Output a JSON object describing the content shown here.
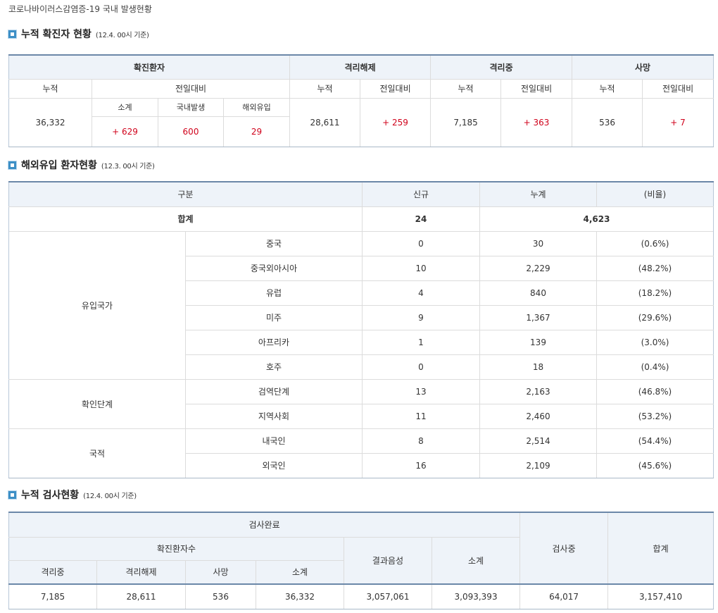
{
  "page_title": "코로나바이러스감염증-19 국내 발생현황",
  "section1": {
    "title": "누적 확진자 현황",
    "note": "(12.4. 00시 기준)",
    "headers": {
      "confirmed": "확진환자",
      "released": "격리해제",
      "isolated": "격리중",
      "deaths": "사망",
      "cumulative": "누적",
      "daily_change": "전일대비",
      "subtotal": "소계",
      "domestic": "국내발생",
      "imported": "해외유입"
    },
    "values": {
      "confirmed_cum": "36,332",
      "confirmed_subtotal": "+ 629",
      "confirmed_domestic": "600",
      "confirmed_imported": "29",
      "released_cum": "28,611",
      "released_change": "+ 259",
      "isolated_cum": "7,185",
      "isolated_change": "+ 363",
      "deaths_cum": "536",
      "deaths_change": "+ 7"
    }
  },
  "section2": {
    "title": "해외유입 환자현황",
    "note": "(12.3. 00시 기준)",
    "headers": {
      "category": "구분",
      "new": "신규",
      "total": "누계",
      "ratio": "(비율)"
    },
    "sum": {
      "label": "합계",
      "new": "24",
      "total": "4,623"
    },
    "groups": [
      {
        "label": "유입국가",
        "rows": [
          {
            "name": "중국",
            "new": "0",
            "total": "30",
            "ratio": "(0.6%)"
          },
          {
            "name": "중국외아시아",
            "new": "10",
            "total": "2,229",
            "ratio": "(48.2%)"
          },
          {
            "name": "유럽",
            "new": "4",
            "total": "840",
            "ratio": "(18.2%)"
          },
          {
            "name": "미주",
            "new": "9",
            "total": "1,367",
            "ratio": "(29.6%)"
          },
          {
            "name": "아프리카",
            "new": "1",
            "total": "139",
            "ratio": "(3.0%)"
          },
          {
            "name": "호주",
            "new": "0",
            "total": "18",
            "ratio": "(0.4%)"
          }
        ]
      },
      {
        "label": "확인단계",
        "rows": [
          {
            "name": "검역단계",
            "new": "13",
            "total": "2,163",
            "ratio": "(46.8%)"
          },
          {
            "name": "지역사회",
            "new": "11",
            "total": "2,460",
            "ratio": "(53.2%)"
          }
        ]
      },
      {
        "label": "국적",
        "rows": [
          {
            "name": "내국인",
            "new": "8",
            "total": "2,514",
            "ratio": "(54.4%)"
          },
          {
            "name": "외국인",
            "new": "16",
            "total": "2,109",
            "ratio": "(45.6%)"
          }
        ]
      }
    ]
  },
  "section3": {
    "title": "누적 검사현황",
    "note": "(12.4. 00시 기준)",
    "headers": {
      "completed": "검사완료",
      "confirmed_count": "확진환자수",
      "negative": "결과음성",
      "subtotal": "소계",
      "testing": "검사중",
      "total": "합계",
      "isolated": "격리중",
      "released": "격리해제",
      "deaths": "사망",
      "conf_subtotal": "소계"
    },
    "values": {
      "isolated": "7,185",
      "released": "28,611",
      "deaths": "536",
      "conf_subtotal": "36,332",
      "negative": "3,057,061",
      "subtotal": "3,093,393",
      "testing": "64,017",
      "total": "3,157,410"
    }
  }
}
